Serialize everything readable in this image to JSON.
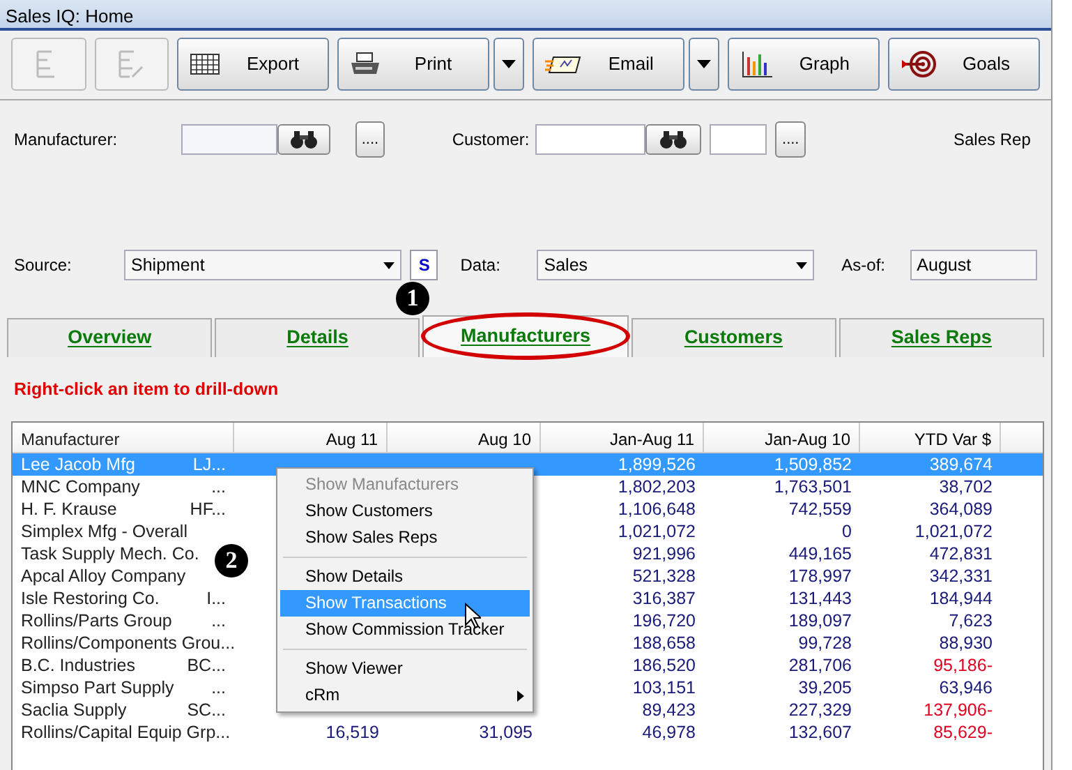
{
  "window": {
    "title": "Sales IQ: Home"
  },
  "toolbar": [
    {
      "kind": "outline",
      "disabled": true
    },
    {
      "kind": "outline-edit",
      "disabled": true
    },
    {
      "kind": "export",
      "label": "Export",
      "disabled": false,
      "has_menu": false
    },
    {
      "kind": "print",
      "label": "Print",
      "disabled": false,
      "has_menu": true
    },
    {
      "kind": "email",
      "label": "Email",
      "disabled": false,
      "has_menu": true
    },
    {
      "kind": "graph",
      "label": "Graph",
      "disabled": false,
      "has_menu": false
    },
    {
      "kind": "goals",
      "label": "Goals",
      "disabled": false,
      "has_menu": false
    }
  ],
  "filters": {
    "manufacturer_label": "Manufacturer:",
    "browse_button": "....",
    "customer_label": "Customer:",
    "customer_browse_button": "....",
    "sales_reps_label": "Sales Rep"
  },
  "source": {
    "label": "Source:",
    "value": "Shipment",
    "currency_button": "S",
    "data_label": "Data:",
    "data_value": "Sales",
    "as_of_label": "As-of:",
    "as_of_value": "August"
  },
  "tabs": [
    {
      "label": "Overview",
      "selected": false
    },
    {
      "label": "Details",
      "selected": false
    },
    {
      "label": "Manufacturers",
      "selected": true
    },
    {
      "label": "Customers",
      "selected": false
    },
    {
      "label": "Sales Reps",
      "selected": false
    }
  ],
  "hint": "Right-click an item to drill-down",
  "table": {
    "columns": [
      "Manufacturer",
      "Aug 11",
      "Aug 10",
      "Jan-Aug 11",
      "Jan-Aug 10",
      "YTD Var $"
    ],
    "rows": [
      {
        "name": "Lee Jacob Mfg",
        "code": "LJ...",
        "ytd_11": "1,899,526",
        "ytd_10": "1,509,852",
        "var": "389,674",
        "negative": false,
        "selected": true
      },
      {
        "name": "MNC Company",
        "code": "...",
        "ytd_11": "1,802,203",
        "ytd_10": "1,763,501",
        "var": "38,702",
        "negative": false,
        "selected": false
      },
      {
        "name": "H. F. Krause",
        "code": "HF...",
        "ytd_11": "1,106,648",
        "ytd_10": "742,559",
        "var": "364,089",
        "negative": false,
        "selected": false
      },
      {
        "name": "Simplex Mfg - Overall",
        "ytd_11": "1,021,072",
        "ytd_10": "0",
        "var": "1,021,072",
        "negative": false,
        "selected": false
      },
      {
        "name": "Task Supply Mech. Co.",
        "ytd_11": "921,996",
        "ytd_10": "449,165",
        "var": "472,831",
        "negative": false,
        "selected": false
      },
      {
        "name": "Apcal Alloy Company",
        "ytd_11": "521,328",
        "ytd_10": "178,997",
        "var": "342,331",
        "negative": false,
        "selected": false
      },
      {
        "name": "Isle Restoring Co.",
        "code": "I...",
        "ytd_11": "316,387",
        "ytd_10": "131,443",
        "var": "184,944",
        "negative": false,
        "selected": false
      },
      {
        "name": "Rollins/Parts Group",
        "code": "...",
        "ytd_11": "196,720",
        "ytd_10": "189,097",
        "var": "7,623",
        "negative": false,
        "selected": false
      },
      {
        "name": "Rollins/Components Grou...",
        "ytd_11": "188,658",
        "ytd_10": "99,728",
        "var": "88,930",
        "negative": false,
        "selected": false
      },
      {
        "name": "B.C. Industries",
        "code": "BC...",
        "ytd_11": "186,520",
        "ytd_10": "281,706",
        "var": "95,186-",
        "negative": true,
        "selected": false
      },
      {
        "name": "Simpso Part Supply",
        "code": "...",
        "ytd_11": "103,151",
        "ytd_10": "39,205",
        "var": "63,946",
        "negative": false,
        "selected": false
      },
      {
        "name": "Saclia Supply",
        "code": "SC...",
        "ytd_11": "89,423",
        "ytd_10": "227,329",
        "var": "137,906-",
        "negative": true,
        "selected": false
      },
      {
        "name": "Rollins/Capital Equip Grp...",
        "aug_11": "16,519",
        "aug_10": "31,095",
        "ytd_11": "46,978",
        "ytd_10": "132,607",
        "var": "85,629-",
        "negative": true,
        "selected": false
      }
    ]
  },
  "context_menu": [
    {
      "kind": "item",
      "label": "Show Manufacturers",
      "disabled": true,
      "selected": false
    },
    {
      "kind": "item",
      "label": "Show Customers",
      "disabled": false,
      "selected": false
    },
    {
      "kind": "item",
      "label": "Show Sales Reps",
      "disabled": false,
      "selected": false
    },
    {
      "kind": "separator"
    },
    {
      "kind": "item",
      "label": "Show Details",
      "disabled": false,
      "selected": false
    },
    {
      "kind": "item",
      "label": "Show Transactions",
      "disabled": false,
      "selected": true
    },
    {
      "kind": "item",
      "label": "Show Commission Tracker",
      "disabled": false,
      "selected": false
    },
    {
      "kind": "separator"
    },
    {
      "kind": "item",
      "label": "Show Viewer",
      "disabled": false,
      "selected": false
    },
    {
      "kind": "submenu",
      "label": "cRm",
      "disabled": false,
      "selected": false
    }
  ],
  "callouts": [
    "1",
    "2"
  ]
}
